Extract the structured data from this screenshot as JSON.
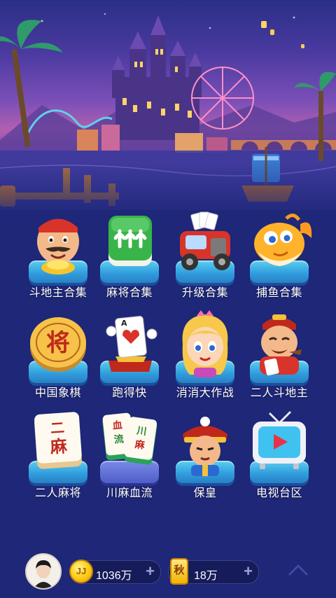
{
  "games": [
    {
      "label": "斗地主合集",
      "icon": "landlord-cards-icon"
    },
    {
      "label": "麻将合集",
      "icon": "mahjong-tile-icon"
    },
    {
      "label": "升级合集",
      "icon": "card-car-icon"
    },
    {
      "label": "捕鱼合集",
      "icon": "goldfish-icon"
    },
    {
      "label": "中国象棋",
      "icon": "chinese-chess-icon"
    },
    {
      "label": "跑得快",
      "icon": "running-card-icon"
    },
    {
      "label": "消消大作战",
      "icon": "girl-match-icon"
    },
    {
      "label": "二人斗地主",
      "icon": "two-player-landlord-icon"
    },
    {
      "label": "二人麻将",
      "icon": "two-player-mahjong-icon"
    },
    {
      "label": "川麻血流",
      "icon": "sichuan-mahjong-icon"
    },
    {
      "label": "保皇",
      "icon": "emperor-guard-icon"
    },
    {
      "label": "电视台区",
      "icon": "tv-area-icon"
    }
  ],
  "bottom_bar": {
    "coin_value": "1036万",
    "coin_glyph": "JJ",
    "card_value": "18万",
    "card_glyph": "秋",
    "plus_label": "+"
  }
}
